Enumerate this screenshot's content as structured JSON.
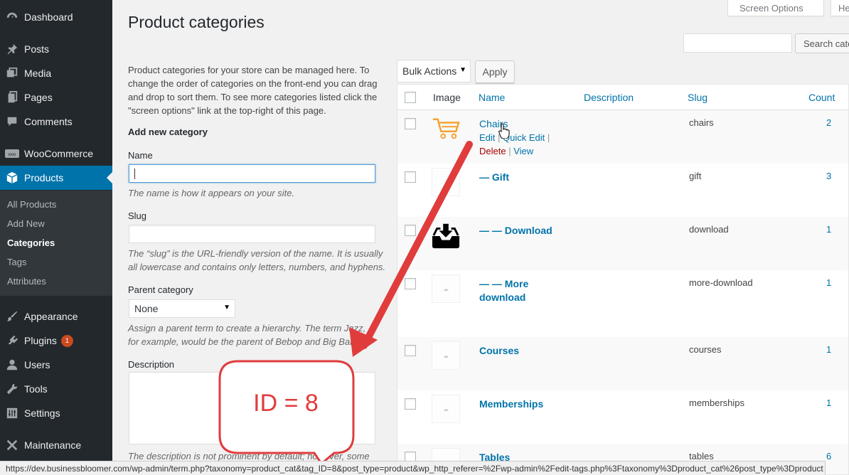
{
  "sidebar": {
    "items": [
      {
        "label": "Dashboard",
        "icon": "dashboard-icon"
      },
      {
        "label": "Posts",
        "icon": "pin-icon"
      },
      {
        "label": "Media",
        "icon": "media-icon"
      },
      {
        "label": "Pages",
        "icon": "pages-icon"
      },
      {
        "label": "Comments",
        "icon": "comments-icon"
      },
      {
        "label": "WooCommerce",
        "icon": "woocommerce-icon"
      },
      {
        "label": "Products",
        "icon": "products-box-icon"
      },
      {
        "label": "Appearance",
        "icon": "brush-icon"
      },
      {
        "label": "Plugins",
        "icon": "plug-icon",
        "badge": "1"
      },
      {
        "label": "Users",
        "icon": "users-icon"
      },
      {
        "label": "Tools",
        "icon": "wrench-icon"
      },
      {
        "label": "Settings",
        "icon": "settings-icon"
      },
      {
        "label": "Maintenance",
        "icon": "maintenance-icon"
      }
    ],
    "submenu": [
      "All Products",
      "Add New",
      "Categories",
      "Tags",
      "Attributes"
    ]
  },
  "header": {
    "screen_options": "Screen Options",
    "help": "He",
    "page_title": "Product categories",
    "search_button": "Search cate"
  },
  "form": {
    "intro": "Product categories for your store can be managed here. To change the order of categories on the front-end you can drag and drop to sort them. To see more categories listed click the \"screen options\" link at the top-right of this page.",
    "heading": "Add new category",
    "name_label": "Name",
    "name_help": "The name is how it appears on your site.",
    "slug_label": "Slug",
    "slug_help": "The “slug” is the URL-friendly version of the name. It is usually all lowercase and contains only letters, numbers, and hyphens.",
    "parent_label": "Parent category",
    "parent_value": "None",
    "parent_help": "Assign a parent term to create a hierarchy. The term Jazz, for example, would be the parent of Bebop and Big Band.",
    "description_label": "Description",
    "description_help": "The description is not prominent by default; however, some"
  },
  "table": {
    "bulk_actions": "Bulk Actions",
    "apply": "Apply",
    "columns": {
      "image": "Image",
      "name": "Name",
      "description": "Description",
      "slug": "Slug",
      "count": "Count"
    },
    "row_actions": {
      "edit": "Edit",
      "quick_edit": "Quick Edit",
      "delete": "Delete",
      "view": "View",
      "sep": "|"
    },
    "rows": [
      {
        "name": "Chairs",
        "slug": "chairs",
        "count": "2",
        "image": "cart-icon"
      },
      {
        "name": "— Gift",
        "slug": "gift",
        "count": "3",
        "image": "placeholder"
      },
      {
        "name": "— — Download",
        "slug": "download",
        "count": "1",
        "image": "download-tray-icon"
      },
      {
        "name": "— — More download",
        "slug": "more-download",
        "count": "1",
        "image": "placeholder"
      },
      {
        "name": "Courses",
        "slug": "courses",
        "count": "1",
        "image": "placeholder"
      },
      {
        "name": "Memberships",
        "slug": "memberships",
        "count": "1",
        "image": "placeholder"
      },
      {
        "name": "Tables",
        "slug": "tables",
        "count": "6",
        "image": "placeholder"
      }
    ]
  },
  "annotation": {
    "callout": "ID = 8",
    "color": "#e03c3c"
  },
  "statusbar": {
    "url": "https://dev.businessbloomer.com/wp-admin/term.php?taxonomy=product_cat&tag_ID=8&post_type=product&wp_http_referer=%2Fwp-admin%2Fedit-tags.php%3Ftaxonomy%3Dproduct_cat%26post_type%3Dproduct"
  },
  "colors": {
    "sidebar": "#23282d",
    "accent": "#0073aa",
    "link": "#0073aa",
    "delete": "#a00",
    "badge": "#ca4a1f"
  }
}
